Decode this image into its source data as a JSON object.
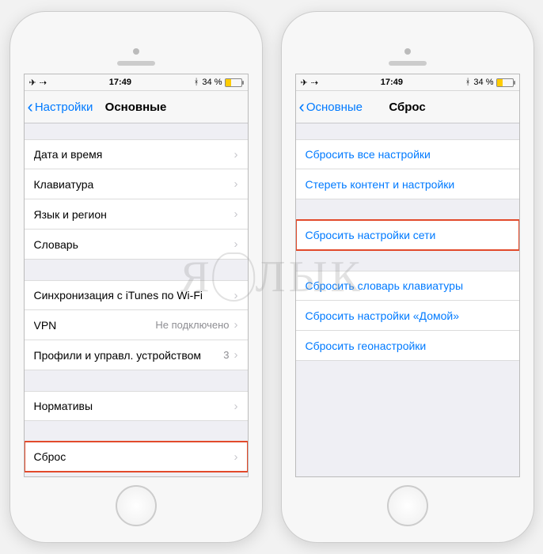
{
  "statusbar": {
    "time": "17:49",
    "battery_pct": "34 %",
    "bluetooth": "⚸",
    "airplane_icon": "✈",
    "wifi_icon": "⇢"
  },
  "left": {
    "back_label": "Настройки",
    "title": "Основные",
    "groups": [
      {
        "cells": [
          {
            "label": "Дата и время",
            "type": "nav"
          },
          {
            "label": "Клавиатура",
            "type": "nav"
          },
          {
            "label": "Язык и регион",
            "type": "nav"
          },
          {
            "label": "Словарь",
            "type": "nav"
          }
        ]
      },
      {
        "cells": [
          {
            "label": "Синхронизация с iTunes по Wi-Fi",
            "type": "nav"
          },
          {
            "label": "VPN",
            "detail": "Не подключено",
            "type": "nav"
          },
          {
            "label": "Профили и управл. устройством",
            "detail": "3",
            "type": "nav"
          }
        ]
      },
      {
        "cells": [
          {
            "label": "Нормативы",
            "type": "nav"
          }
        ]
      },
      {
        "cells": [
          {
            "label": "Сброс",
            "type": "nav",
            "highlight": true
          }
        ]
      }
    ]
  },
  "right": {
    "back_label": "Основные",
    "title": "Сброс",
    "groups": [
      {
        "cells": [
          {
            "label": "Сбросить все настройки",
            "type": "link"
          },
          {
            "label": "Стереть контент и настройки",
            "type": "link"
          }
        ]
      },
      {
        "cells": [
          {
            "label": "Сбросить настройки сети",
            "type": "link",
            "highlight": true
          }
        ]
      },
      {
        "cells": [
          {
            "label": "Сбросить словарь клавиатуры",
            "type": "link"
          },
          {
            "label": "Сбросить настройки «Домой»",
            "type": "link"
          },
          {
            "label": "Сбросить геонастройки",
            "type": "link"
          }
        ]
      }
    ]
  },
  "watermark": {
    "part1": "Я",
    "part2": "ЛЫК"
  }
}
